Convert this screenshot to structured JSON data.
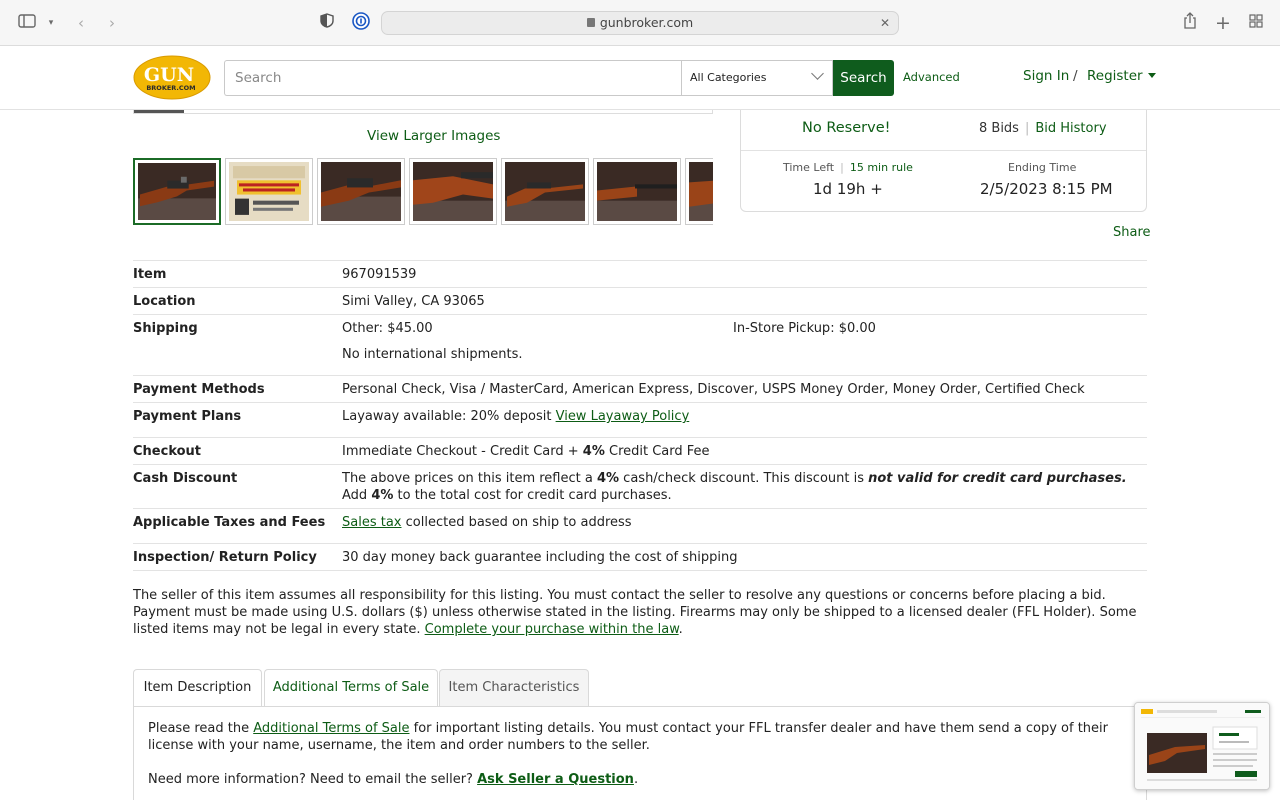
{
  "browser": {
    "url": "gunbroker.com"
  },
  "header": {
    "logo_text_top": "GUN",
    "logo_text_bottom": "BROKER.COM",
    "search_placeholder": "Search",
    "category_selected": "All Categories",
    "search_button": "Search",
    "advanced_link": "Advanced",
    "sign_in": "Sign In",
    "separator": "/",
    "register": "Register"
  },
  "gallery": {
    "view_larger": "View Larger Images",
    "thumbnails": [
      {
        "kind": "rifle-action"
      },
      {
        "kind": "store-ad"
      },
      {
        "kind": "rifle-action"
      },
      {
        "kind": "stock"
      },
      {
        "kind": "rifle-full"
      },
      {
        "kind": "barrel"
      },
      {
        "kind": "partial"
      }
    ]
  },
  "bid_box": {
    "no_reserve": "No Reserve!",
    "bids": "8 Bids",
    "bid_history": "Bid History",
    "time_left_label": "Time Left",
    "rule": "15 min rule",
    "time_left_value": "1d 19h +",
    "ending_label": "Ending Time",
    "ending_value": "2/5/2023 8:15 PM"
  },
  "share": "Share",
  "details": {
    "item_label": "Item",
    "item_value": "967091539",
    "location_label": "Location",
    "location_value": "Simi Valley, CA 93065",
    "shipping_label": "Shipping",
    "shipping_other": "Other:  $45.00",
    "shipping_pickup": "In-Store Pickup:  $0.00",
    "shipping_note": "No international shipments.",
    "payment_methods_label": "Payment Methods",
    "payment_methods_value": "Personal Check, Visa / MasterCard, American Express, Discover, USPS Money Order, Money Order, Certified Check",
    "payment_plans_label": "Payment Plans",
    "payment_plans_text": "Layaway available: 20% deposit",
    "payment_plans_link": "View Layaway Policy",
    "checkout_label": "Checkout",
    "checkout_pre": "Immediate Checkout - Credit Card + ",
    "checkout_bold": "4%",
    "checkout_post": " Credit Card Fee",
    "cash_discount_label": "Cash Discount",
    "cash_pre": "The above prices on this item reflect a ",
    "cash_bold1": "4%",
    "cash_mid": " cash/check discount. This discount is ",
    "cash_italic": "not valid for credit card purchases.",
    "cash_mid2": " Add ",
    "cash_bold2": "4%",
    "cash_post": " to the total cost for credit card purchases.",
    "taxes_label": "Applicable Taxes and Fees",
    "taxes_link": "Sales tax",
    "taxes_text": " collected based on ship to address",
    "return_label": "Inspection/ Return Policy",
    "return_value": "30 day money back guarantee including the cost of shipping"
  },
  "disclaimer": {
    "text": "The seller of this item assumes all responsibility for this listing. You must contact the seller to resolve any questions or concerns before placing a bid. Payment must be made using U.S. dollars ($) unless otherwise stated in the listing. Firearms may only be shipped to a licensed dealer (FFL Holder). Some listed items may not be legal in every state. ",
    "link": "Complete your purchase within the law",
    "end": "."
  },
  "tabs": {
    "description": "Item Description",
    "terms": "Additional Terms of Sale",
    "characteristics": "Item Characteristics"
  },
  "tab_content": {
    "p1_pre": "Please read the ",
    "p1_link": "Additional Terms of Sale",
    "p1_post": " for important listing details. You must contact your FFL transfer dealer and have them send a copy of their license with your name, username, the item and order numbers to the seller.",
    "p2_pre": "Need more information? Need to email the seller? ",
    "p2_link": "Ask Seller a Question",
    "p2_post": "."
  },
  "colors": {
    "brand_green": "#0f5c1d",
    "logo_yellow": "#f2b705"
  }
}
